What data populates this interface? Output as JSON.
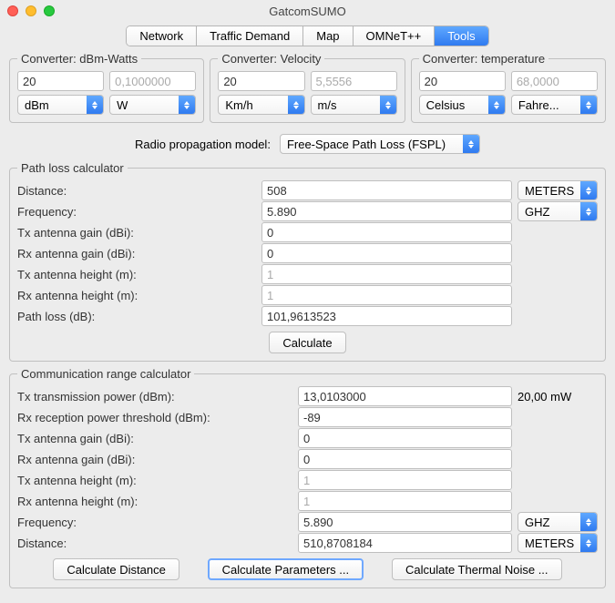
{
  "window": {
    "title": "GatcomSUMO"
  },
  "tabs": [
    "Network",
    "Traffic Demand",
    "Map",
    "OMNeT++",
    "Tools"
  ],
  "active_tab": 4,
  "converters": {
    "dbm": {
      "legend": "Converter: dBm-Watts",
      "in_val": "20",
      "out_val": "0,1000000",
      "unit_in": "dBm",
      "unit_out": "W"
    },
    "vel": {
      "legend": "Converter: Velocity",
      "in_val": "20",
      "out_val": "5,5556",
      "unit_in": "Km/h",
      "unit_out": "m/s"
    },
    "temp": {
      "legend": "Converter: temperature",
      "in_val": "20",
      "out_val": "68,0000",
      "unit_in": "Celsius",
      "unit_out": "Fahre..."
    }
  },
  "model": {
    "label": "Radio propagation model:",
    "value": "Free-Space Path Loss (FSPL)"
  },
  "pathloss": {
    "legend": "Path loss calculator",
    "rows": {
      "distance": {
        "label": "Distance:",
        "value": "508",
        "side_unit": "METERS"
      },
      "frequency": {
        "label": "Frequency:",
        "value": "5.890",
        "side_unit": "GHZ"
      },
      "txgain": {
        "label": "Tx antenna gain (dBi):",
        "value": "0"
      },
      "rxgain": {
        "label": "Rx antenna gain (dBi):",
        "value": "0"
      },
      "txheight": {
        "label": "Tx antenna height (m):",
        "value": "1",
        "dim": true
      },
      "rxheight": {
        "label": "Rx antenna height (m):",
        "value": "1",
        "dim": true
      },
      "loss": {
        "label": "Path loss (dB):",
        "value": "101,9613523"
      }
    },
    "button": "Calculate"
  },
  "comm": {
    "legend": "Communication range calculator",
    "rows": {
      "txpower": {
        "label": "Tx transmission power (dBm):",
        "value": "13,0103000",
        "side_text": "20,00 mW"
      },
      "rxthresh": {
        "label": "Rx reception power threshold (dBm):",
        "value": "-89"
      },
      "txgain": {
        "label": "Tx antenna gain (dBi):",
        "value": "0"
      },
      "rxgain": {
        "label": "Rx antenna gain (dBi):",
        "value": "0"
      },
      "txheight": {
        "label": "Tx antenna height (m):",
        "value": "1",
        "dim": true
      },
      "rxheight": {
        "label": "Rx antenna height (m):",
        "value": "1",
        "dim": true
      },
      "frequency": {
        "label": "Frequency:",
        "value": "5.890",
        "side_unit": "GHZ"
      },
      "distance": {
        "label": "Distance:",
        "value": "510,8708184",
        "side_unit": "METERS"
      }
    },
    "buttons": {
      "calc_dist": "Calculate Distance",
      "calc_params": "Calculate Parameters ...",
      "calc_noise": "Calculate Thermal Noise ..."
    }
  }
}
